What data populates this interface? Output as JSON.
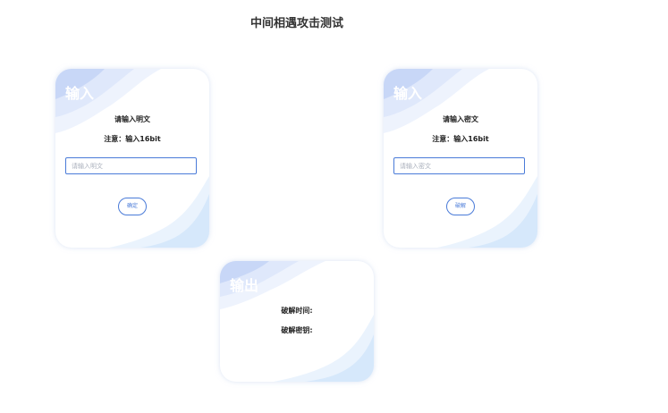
{
  "page": {
    "title": "中间相遇攻击测试"
  },
  "cards": {
    "encrypt": {
      "heading": "输入",
      "prompt": "请输入明文",
      "note": "注意：输入16bit",
      "input": {
        "placeholder": "请输入明文",
        "value": ""
      },
      "button_label": "确定"
    },
    "decrypt": {
      "heading": "输入",
      "prompt": "请输入密文",
      "note": "注意：输入16bit",
      "input": {
        "placeholder": "请输入密文",
        "value": ""
      },
      "button_label": "破解"
    },
    "output": {
      "heading": "输出",
      "time_label": "破解时间:",
      "key_label": "破解密钥:"
    }
  },
  "colors": {
    "accent": "#4a7bd8",
    "wave_light": "#e8effc",
    "wave_mid": "#d3e0fa",
    "wave_dark": "#c2d2f7"
  }
}
